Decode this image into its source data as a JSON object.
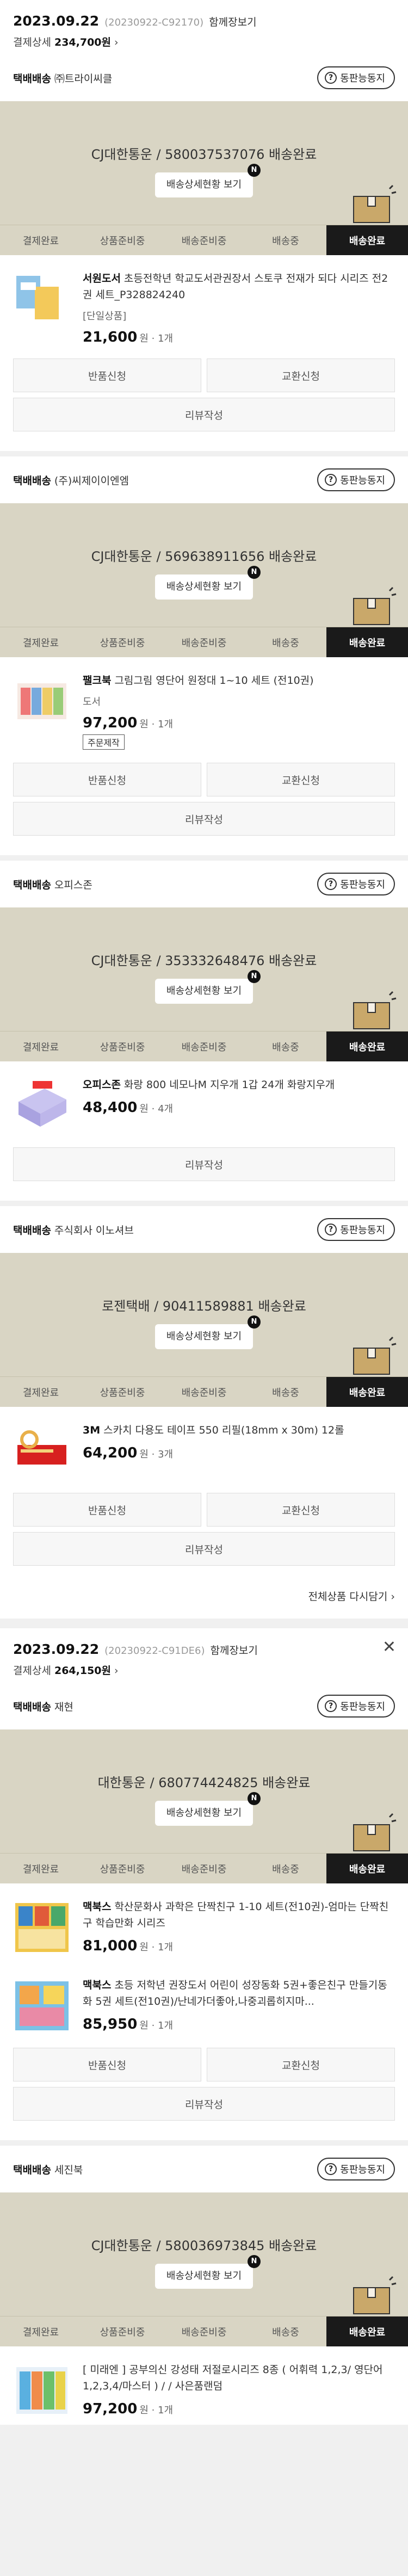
{
  "labels": {
    "ask": "동판능동지",
    "detail": "배송상세현황 보기",
    "badge": "N",
    "return": "반품신청",
    "exchange": "교환신청",
    "review": "리뷰작성",
    "more": "전체상품 다시담기",
    "order_link": "함께장보기",
    "pay_label": "결제상세",
    "steps": [
      "결제완료",
      "상품준비중",
      "배송준비중",
      "배송중",
      "배송완료"
    ]
  },
  "orders": [
    {
      "date": "2023.09.22",
      "no": "(20230922-C92170)",
      "total": "234,700원",
      "packages": [
        {
          "type": "택배배송",
          "seller": "㈜트라이씨클",
          "courier": "CJ대한통운 / 580037537076 배송완료",
          "item": {
            "brand": "서원도서",
            "title": "초등전학년 학교도서관권장서 스토쿠 전재가 되다 시리즈 전2권 세트_P328824240",
            "opt": "[단일상품]",
            "price": "21,600",
            "qty": "원 · 1개"
          }
        },
        {
          "type": "택배배송",
          "seller": "(주)씨제이이엔엠",
          "courier": "CJ대한통운 / 569638911656 배송완료",
          "item": {
            "brand": "팰크북",
            "title": "그림그림 영단어 원정대 1~10 세트 (전10권)",
            "opt": "도서",
            "price": "97,200",
            "qty": "원 · 1개",
            "tag": "주문제작"
          }
        },
        {
          "type": "택배배송",
          "seller": "오피스존",
          "courier": "CJ대한통운 / 353332648476 배송완료",
          "item": {
            "brand": "오피스존",
            "title": "화랑 800 네모나M 지우개 1갑 24개 화랑지우개",
            "price": "48,400",
            "qty": "원 · 4개"
          }
        },
        {
          "type": "택배배송",
          "seller": "주식회사 이노셔브",
          "courier": "로젠택배 / 90411589881 배송완료",
          "item": {
            "brand": "3M",
            "title": "스카치 다용도 테이프 550 리필(18mm x 30m) 12롤",
            "price": "64,200",
            "qty": "원 · 3개"
          }
        }
      ]
    },
    {
      "date": "2023.09.22",
      "no": "(20230922-C91DE6)",
      "total": "264,150원",
      "packages": [
        {
          "type": "택배배송",
          "seller": "재현",
          "courier": "대한통운 / 680774424825 배송완료",
          "items": [
            {
              "brand": "맥북스",
              "title": "학산문화사 과학은 단짝친구 1-10 세트(전10권)-엄마는 단짝친구 학습만화 시리즈",
              "price": "81,000",
              "qty": "원 · 1개"
            },
            {
              "brand": "맥북스",
              "title": "초등 저학년 권장도서 어린이 성장동화 5권+좋은친구 만들기동화 5권 세트(전10권)/난네가더좋아,나중괴롭히지마...",
              "price": "85,950",
              "qty": "원 · 1개"
            }
          ]
        },
        {
          "type": "택배배송",
          "seller": "세진북",
          "courier": "CJ대한통운 / 580036973845 배송완료",
          "item": {
            "brand": "",
            "title": "[ 미래엔 ] 공부의신 강성태 저절로시리즈 8종 ( 어휘력 1,2,3/ 영단어1,2,3,4/마스터 ) / / 사은품랜덤",
            "price": "97,200",
            "qty": "원 · 1개"
          }
        }
      ]
    }
  ]
}
